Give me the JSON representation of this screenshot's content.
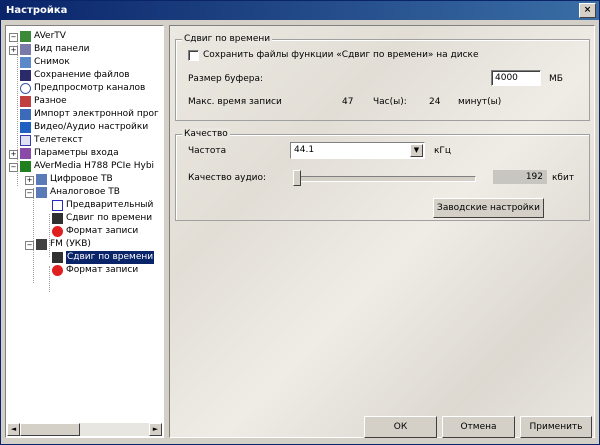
{
  "window": {
    "title": "Настройка",
    "close_glyph": "×"
  },
  "tree": {
    "items": [
      {
        "label": "AVerTV",
        "icon": "averTV-icon"
      },
      {
        "label": "Вид панели",
        "icon": "panel-view-icon"
      },
      {
        "label": "Снимок",
        "icon": "snapshot-icon"
      },
      {
        "label": "Сохранение файлов",
        "icon": "save-files-icon"
      },
      {
        "label": "Предпросмотр каналов",
        "icon": "eye-icon"
      },
      {
        "label": "Разное",
        "icon": "misc-icon"
      },
      {
        "label": "Импорт электронной прог",
        "icon": "epg-import-icon"
      },
      {
        "label": "Видео/Аудио настройки",
        "icon": "av-settings-icon"
      },
      {
        "label": "Телетекст",
        "icon": "teletext-icon"
      },
      {
        "label": "Параметры входа",
        "icon": "input-params-icon"
      },
      {
        "label": "AVerMedia H788 PCIe Hybi",
        "icon": "tuner-card-icon"
      },
      {
        "label": "Цифровое ТВ",
        "icon": "digital-tv-icon"
      },
      {
        "label": "Аналоговое ТВ",
        "icon": "analog-tv-icon"
      },
      {
        "label": "Предварительный",
        "icon": "preview-check-icon"
      },
      {
        "label": "Сдвиг по времени",
        "icon": "timeshift-icon"
      },
      {
        "label": "Формат записи",
        "icon": "record-format-icon"
      },
      {
        "label": "FM (УКВ)",
        "icon": "radio-icon"
      },
      {
        "label": "Сдвиг по времени",
        "icon": "timeshift-icon"
      },
      {
        "label": "Формат записи",
        "icon": "record-format-icon"
      }
    ],
    "scroll_left": "◄",
    "scroll_right": "►"
  },
  "timeshift": {
    "title": "Сдвиг по времени",
    "save_label": "Сохранить файлы функции «Сдвиг по времени» на диске",
    "buffer_label": "Размер буфера:",
    "buffer_value": "4000",
    "buffer_unit": "МБ",
    "max_label": "Макс. время записи",
    "hours_value": "47",
    "hours_unit": "Час(ы):",
    "minutes_value": "24",
    "minutes_unit": "минут(ы)"
  },
  "quality": {
    "title": "Качество",
    "freq_label": "Частота",
    "freq_value": "44.1",
    "freq_unit": "кГц",
    "dropdown_glyph": "▼",
    "audio_label": "Качество аудио:",
    "audio_value": "192",
    "audio_unit": "кбит",
    "audio_level": 0.0,
    "defaults_button": "Заводские настройки"
  },
  "footer": {
    "ok": "ОК",
    "cancel": "Отмена",
    "apply": "Применить"
  },
  "colors": {
    "title_bar": "#0a246a",
    "selection": "#0a246a",
    "window_bg": "#d4d0c8"
  }
}
